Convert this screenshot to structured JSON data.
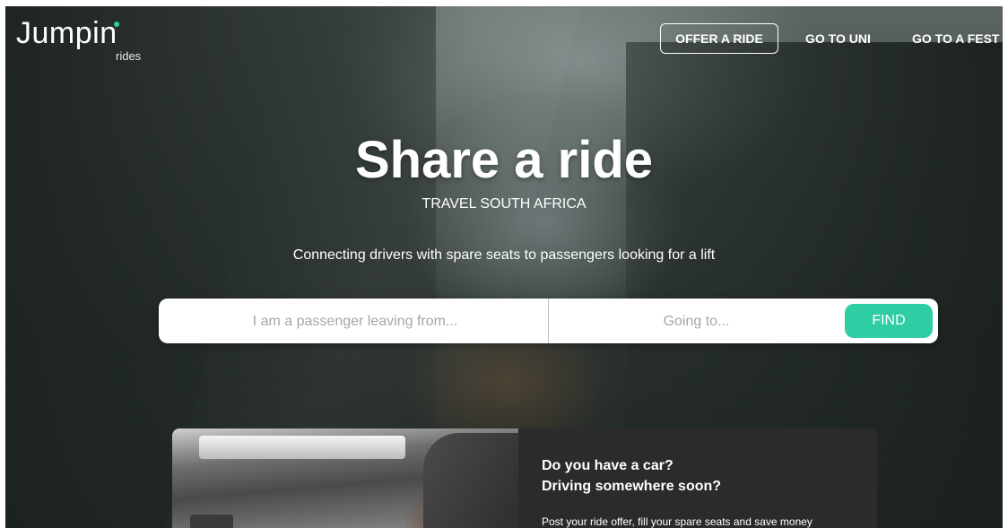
{
  "brand": {
    "name": "Jumpin",
    "sub": "rides",
    "accent": "#2ecda4"
  },
  "nav": {
    "offer": "OFFER A RIDE",
    "uni": "GO TO UNI",
    "fest": "GO TO A FEST"
  },
  "hero": {
    "title": "Share a ride",
    "subtitle": "TRAVEL SOUTH AFRICA",
    "tagline": "Connecting drivers with spare seats to passengers looking for a lift"
  },
  "search": {
    "from_placeholder": "I am a passenger leaving from...",
    "to_placeholder": "Going to...",
    "find_label": "FIND"
  },
  "card": {
    "question1": "Do you have a car?",
    "question2": "Driving somewhere soon?",
    "body": "Post your ride offer, fill your spare seats and save money"
  }
}
